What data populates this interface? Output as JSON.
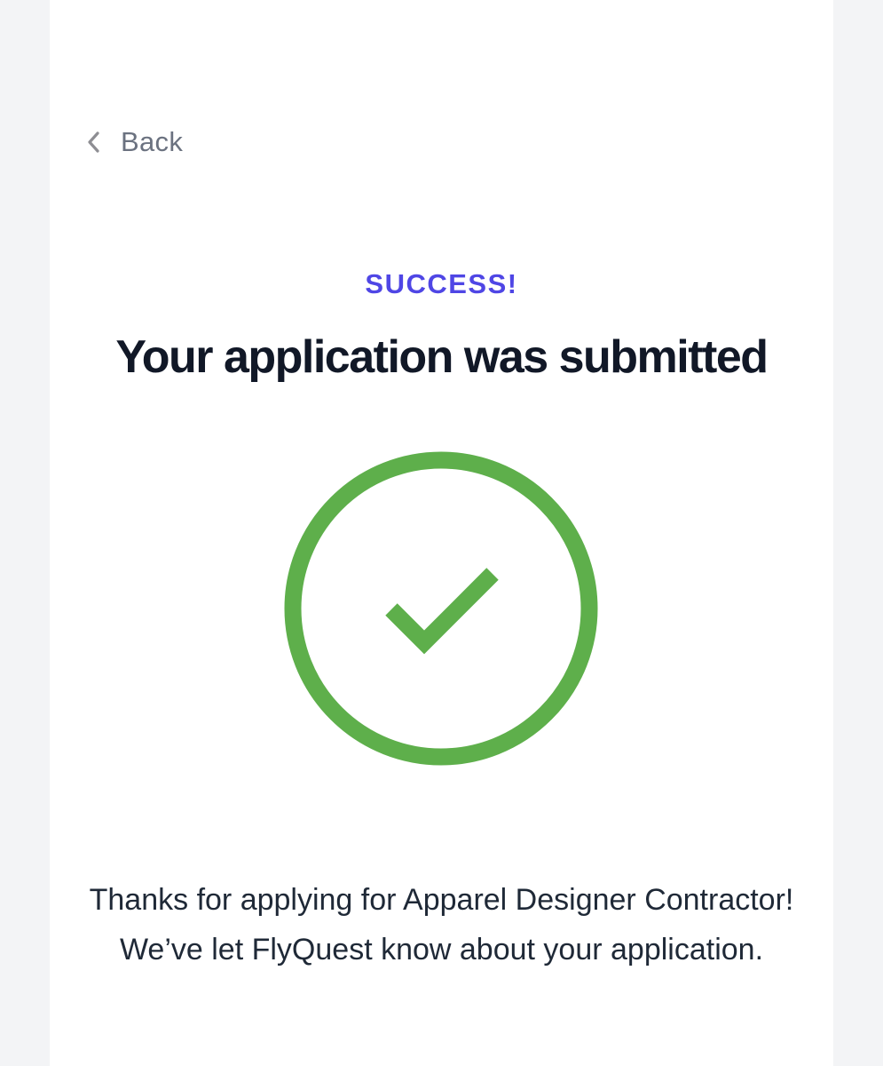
{
  "nav": {
    "back_label": "Back",
    "back_icon": "chevron-left-icon"
  },
  "status": {
    "eyebrow": "SUCCESS!",
    "headline": "Your application was submitted",
    "icon": "check-circle-icon",
    "icon_color": "#5eaf4b",
    "accent_color": "#4f46e5"
  },
  "message": {
    "text": "Thanks for applying for Apparel Designer Contractor! We’ve let FlyQuest know about your application."
  }
}
